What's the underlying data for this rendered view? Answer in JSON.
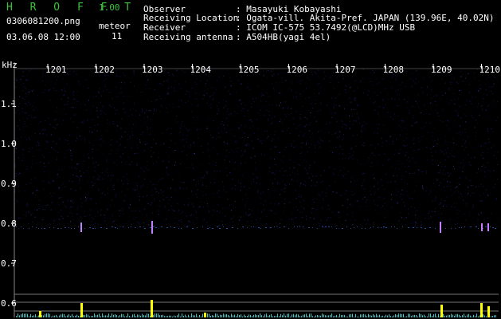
{
  "app": {
    "name": "H R O F F T",
    "version": "1.00"
  },
  "file": {
    "name": "0306081200.png",
    "datetime": "03.06.08 12:00"
  },
  "meteor": {
    "label": "meteor",
    "count": "11"
  },
  "info": {
    "observer": {
      "label": "Observer",
      "value": ": Masayuki Kobayashi"
    },
    "location": {
      "label": "Receiving Location",
      "value": ": Ogata-vill. Akita-Pref. JAPAN (139.96E, 40.02N)"
    },
    "receiver": {
      "label": "Receiver",
      "value": ": ICOM IC-575 53.7492(@LCD)MHz USB"
    },
    "antenna": {
      "label": "Receiving antenna",
      "value": ": A504HB(yagi 4el)"
    }
  },
  "spectrogram": {
    "y_unit": "kHz",
    "time_labels": [
      "1201",
      "1202",
      "1203",
      "1204",
      "1205",
      "1206",
      "1207",
      "1208",
      "1209",
      "1210"
    ],
    "freq_labels": [
      "1.1",
      "1.0",
      "0.9",
      "0.8",
      "0.7",
      "0.6"
    ],
    "carrier_khz": 0.79
  },
  "colors": {
    "text": "#ffffff",
    "logo": "#3cc33c",
    "background": "#000000",
    "noise": "#1a1a6e",
    "echo": "#ffff00",
    "carrier": "#4080ff"
  }
}
